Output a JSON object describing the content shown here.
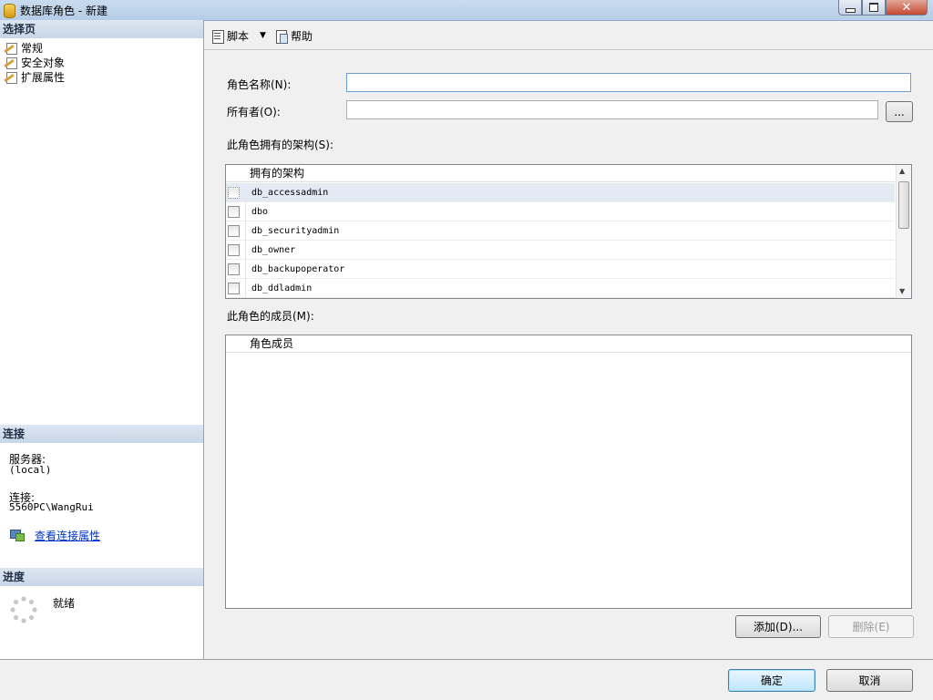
{
  "window": {
    "title": "数据库角色 - 新建"
  },
  "left": {
    "select_page_header": "选择页",
    "pages": [
      {
        "label": "常规"
      },
      {
        "label": "安全对象"
      },
      {
        "label": "扩展属性"
      }
    ],
    "connection_header": "连接",
    "server_label": "服务器:",
    "server_value": "(local)",
    "connection_label": "连接:",
    "connection_value": "5560PC\\WangRui",
    "view_connection_link": "查看连接属性",
    "progress_header": "进度",
    "progress_status": "就绪"
  },
  "toolbar": {
    "script_label": "脚本",
    "help_label": "帮助"
  },
  "form": {
    "role_name_label": "角色名称(N):",
    "role_name_value": "",
    "owner_label": "所有者(O):",
    "owner_value": "",
    "browse_label": "...",
    "schemas_label": "此角色拥有的架构(S):",
    "schemas_column": "拥有的架构",
    "schemas": [
      {
        "name": "db_accessadmin",
        "checked": false
      },
      {
        "name": "dbo",
        "checked": false
      },
      {
        "name": "db_securityadmin",
        "checked": false
      },
      {
        "name": "db_owner",
        "checked": false
      },
      {
        "name": "db_backupoperator",
        "checked": false
      },
      {
        "name": "db_ddladmin",
        "checked": false
      }
    ],
    "members_label": "此角色的成员(M):",
    "members_column": "角色成员",
    "add_label": "添加(D)...",
    "remove_label": "删除(E)"
  },
  "footer": {
    "ok_label": "确定",
    "cancel_label": "取消"
  }
}
